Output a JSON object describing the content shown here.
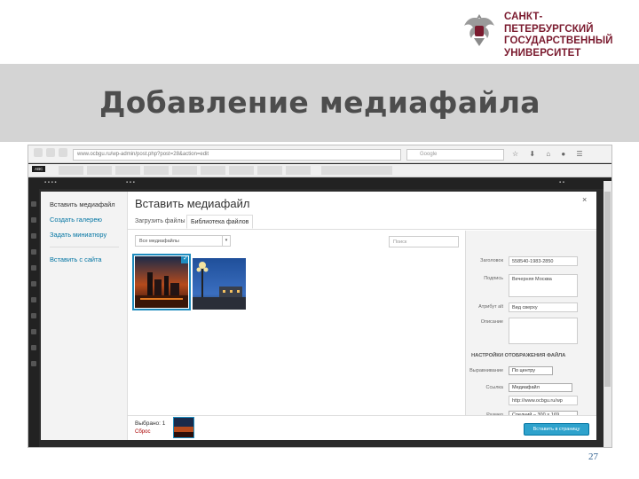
{
  "logo": {
    "line1": "САНКТ-ПЕТЕРБУРГСКИЙ",
    "line2": "ГОСУДАРСТВЕННЫЙ",
    "line3": "УНИВЕРСИТЕТ"
  },
  "slide_title": "Добавление медиафайла",
  "browser": {
    "url": "www.ocbgu.ru/wp-admin/post.php?post=28&action=edit",
    "search_placeholder": "Google"
  },
  "modal": {
    "menu": {
      "insert_media": "Вставить медиафайл",
      "create_gallery": "Создать галерею",
      "set_thumbnail": "Задать миниатюру",
      "insert_from_url": "Вставить с сайта"
    },
    "title": "Вставить медиафайл",
    "close": "×",
    "tabs": {
      "upload": "Загрузить файлы",
      "library": "Библиотека файлов"
    },
    "filter_value": "Все медиафайлы",
    "search_placeholder": "Поиск",
    "details": {
      "dimensions_label": "Заголовок",
      "dimensions_value": "558540-1983-2850",
      "caption_label": "Подпись",
      "caption_value": "Вечерняя Москва",
      "alt_label": "Атрибут alt",
      "alt_value": "Вид сверху",
      "description_label": "Описание",
      "display_settings": "НАСТРОЙКИ ОТОБРАЖЕНИЯ ФАЙЛА",
      "align_label": "Выравнивание",
      "align_value": "По центру",
      "link_label": "Ссылка",
      "link_value": "Медиафайл",
      "link_url": "http://www.ocbgu.ru/wp",
      "size_label": "Размер",
      "size_value": "Средний – 300 × 169"
    },
    "bottom": {
      "selected_label": "Выбрано: 1",
      "clear": "Сброс",
      "insert_button": "Вставить в страницу"
    }
  },
  "page_number": "27",
  "colors": {
    "title_band": "#d4d4d4",
    "logo_text": "#7a1a2e",
    "wp_accent": "#2ea2cc"
  }
}
